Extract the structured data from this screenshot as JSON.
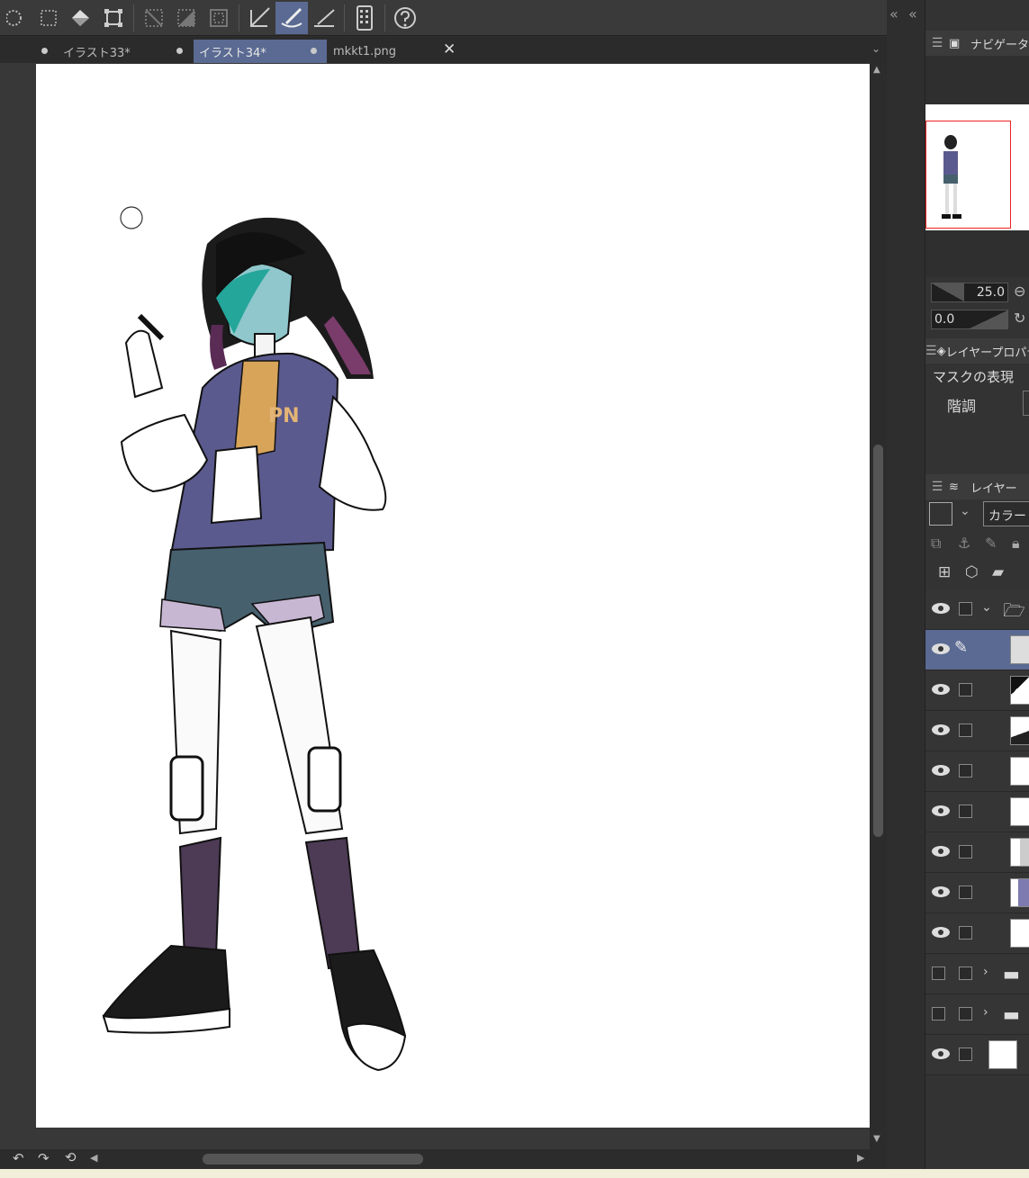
{
  "toolbar": {
    "tools": [
      {
        "icon": "lasso-dotted-icon"
      },
      {
        "icon": "dotted-select-icon"
      },
      {
        "icon": "fill-bucket-icon"
      },
      {
        "icon": "transform-icon"
      },
      {
        "icon": "select-clear-icon"
      },
      {
        "icon": "select-invert-icon"
      },
      {
        "icon": "select-border-icon"
      },
      {
        "icon": "pen-ruler-icon"
      },
      {
        "icon": "brush-active-icon"
      },
      {
        "icon": "pen-baseline-icon"
      },
      {
        "icon": "device-icon"
      },
      {
        "icon": "help-icon"
      }
    ],
    "active_index": 8
  },
  "tabs": [
    {
      "label": "イラスト33*",
      "modified": true
    },
    {
      "label": "イラスト34*",
      "modified": true,
      "active": true
    },
    {
      "label": "mkkt1.png",
      "closable": true
    }
  ],
  "navigator": {
    "title": "ナビゲータ",
    "zoom": "25.0",
    "rotation": "0.0"
  },
  "layer_property": {
    "title": "レイヤープロパティ",
    "mask_label": "マスクの表現",
    "gradation_label": "階調"
  },
  "layers_panel": {
    "title": "レイヤー",
    "blend_mode": "カラー",
    "rows": [
      {
        "visible": true,
        "type": "folder-open",
        "selected": false
      },
      {
        "visible": true,
        "type": "layer",
        "selected": true
      },
      {
        "visible": true,
        "type": "layer",
        "selected": false
      },
      {
        "visible": true,
        "type": "layer",
        "selected": false
      },
      {
        "visible": true,
        "type": "layer",
        "selected": false
      },
      {
        "visible": true,
        "type": "layer",
        "selected": false
      },
      {
        "visible": true,
        "type": "layer",
        "selected": false
      },
      {
        "visible": true,
        "type": "layer",
        "selected": false
      },
      {
        "visible": true,
        "type": "layer",
        "selected": false
      },
      {
        "visible": false,
        "type": "folder-closed",
        "selected": false
      },
      {
        "visible": false,
        "type": "folder-closed",
        "selected": false
      },
      {
        "visible": true,
        "type": "paper",
        "selected": false
      }
    ]
  },
  "colors": {
    "accent": "#5a6a92",
    "jacket": "#5b5a8e",
    "shorts": "#46606e",
    "hair_tips": "#2aa69a",
    "socks": "#4d3a55"
  }
}
